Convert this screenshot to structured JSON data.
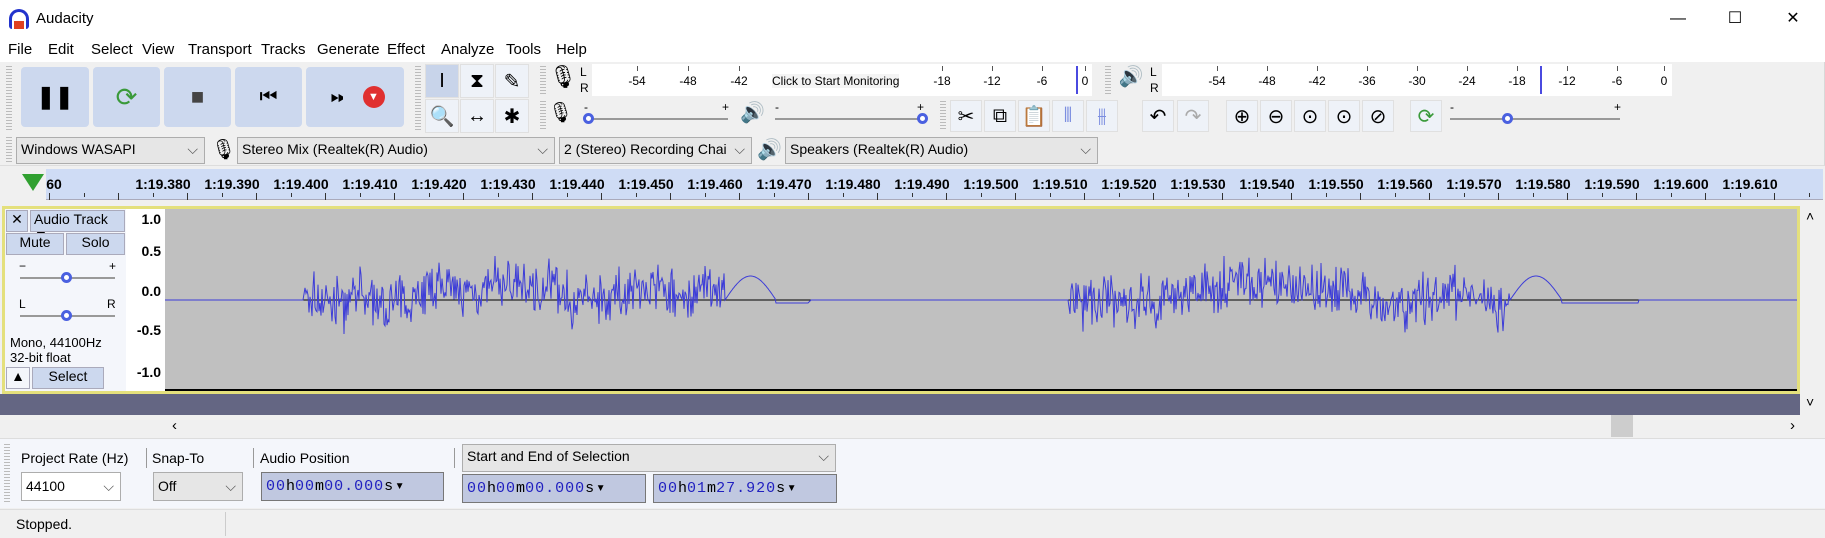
{
  "window": {
    "title": "Audacity",
    "minimize": "—",
    "maximize": "☐",
    "close": "✕"
  },
  "menu": [
    "File",
    "Edit",
    "Select",
    "View",
    "Transport",
    "Tracks",
    "Generate",
    "Effect",
    "Analyze",
    "Tools",
    "Help"
  ],
  "transport": {
    "pause": "❚❚",
    "loop": "⟳",
    "stop": "■",
    "skip_start": "⏮",
    "skip_end": "⏭",
    "record": "▼"
  },
  "tools": [
    "I",
    "⧗",
    "✎",
    "🔍",
    "↔",
    "✱"
  ],
  "record_meter": {
    "channels": [
      "L",
      "R"
    ],
    "ticks": [
      "-54",
      "-48",
      "-42",
      "-18",
      "-12",
      "-6",
      "0"
    ],
    "prompt": "Click to Start Monitoring"
  },
  "play_meter": {
    "channels": [
      "L",
      "R"
    ],
    "ticks": [
      "-54",
      "-48",
      "-42",
      "-36",
      "-30",
      "-24",
      "-18",
      "-12",
      "-6",
      "0"
    ]
  },
  "mixer": {
    "minus": "-",
    "plus": "+",
    "mic_level": 0.0,
    "speaker_level": 1.0
  },
  "edit": [
    "✂",
    "⧉",
    "📋",
    "⫴",
    "⫵"
  ],
  "undo": "↶",
  "redo": "↷",
  "zoom": [
    "⊕",
    "⊖",
    "⊙",
    "⊙",
    "⊘"
  ],
  "play_speed": {
    "minus": "-",
    "plus": "+",
    "level": 0.35
  },
  "devices": {
    "host": "Windows WASAPI",
    "input": "Stereo Mix (Realtek(R) Audio)",
    "channels": "2 (Stereo) Recording Chai",
    "output": "Speakers (Realtek(R) Audio)"
  },
  "ruler": {
    "partial": "60",
    "labels": [
      "1:19.380",
      "1:19.390",
      "1:19.400",
      "1:19.410",
      "1:19.420",
      "1:19.430",
      "1:19.440",
      "1:19.450",
      "1:19.460",
      "1:19.470",
      "1:19.480",
      "1:19.490",
      "1:19.500",
      "1:19.510",
      "1:19.520",
      "1:19.530",
      "1:19.540",
      "1:19.550",
      "1:19.560",
      "1:19.570",
      "1:19.580",
      "1:19.590",
      "1:19.600",
      "1:19.610"
    ]
  },
  "track": {
    "name": "Audio Track",
    "close": "✕",
    "mute": "Mute",
    "solo": "Solo",
    "gain_minus": "−",
    "gain_plus": "+",
    "pan_left": "L",
    "pan_right": "R",
    "gain": 0.5,
    "pan": 0.5,
    "info1": "Mono, 44100Hz",
    "info2": "32-bit float",
    "collapse": "▲",
    "select": "Select",
    "scale": [
      "1.0",
      "0.5",
      "0.0",
      "-0.5",
      "-1.0"
    ],
    "wave_color": "#3c3cd8"
  },
  "selbar": {
    "rate_label": "Project Rate (Hz)",
    "rate": "44100",
    "snap_label": "Snap-To",
    "snap": "Off",
    "pos_label": "Audio Position",
    "pos": [
      "00",
      "h",
      "00",
      "m",
      "00.000",
      "s"
    ],
    "sel_mode": "Start and End of Selection",
    "start": [
      "00",
      "h",
      "00",
      "m",
      "00.000",
      "s"
    ],
    "end": [
      "00",
      "h",
      "01",
      "m",
      "27.920",
      "s"
    ]
  },
  "status": "Stopped."
}
